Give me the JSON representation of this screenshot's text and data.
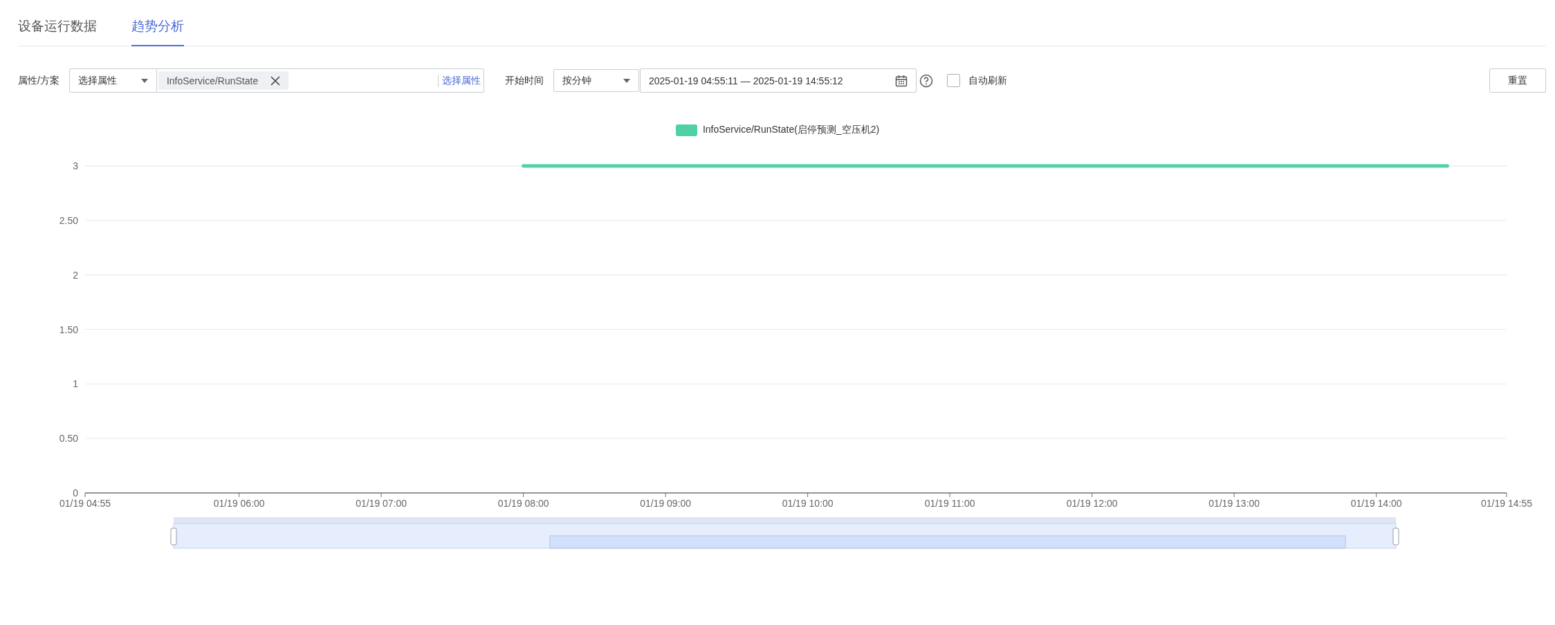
{
  "tabs": [
    {
      "label": "设备运行数据",
      "selected": false
    },
    {
      "label": "趋势分析",
      "selected": true
    }
  ],
  "filters": {
    "attribute_label": "属性/方案",
    "attribute_select": "选择属性",
    "attribute_tag": "InfoService/RunState",
    "attribute_link": "选择属性",
    "time_label": "开始时间",
    "granularity_select": "按分钟",
    "date_range": "2025-01-19 04:55:11 — 2025-01-19 14:55:12",
    "auto_refresh": {
      "label": "自动刷新",
      "checked": false
    },
    "reset_button": "重置"
  },
  "chart_data": {
    "type": "line",
    "grid": true,
    "categories": [
      "01/19 04:55",
      null,
      null,
      null,
      null,
      null,
      null,
      null,
      null,
      null,
      null,
      null,
      null,
      "01/19 06:00",
      null,
      null,
      null,
      null,
      null,
      null,
      null,
      null,
      null,
      null,
      null,
      "01/19 07:00",
      null,
      null,
      null,
      null,
      null,
      null,
      null,
      null,
      null,
      null,
      null,
      "01/19 08:00",
      null,
      null,
      null,
      null,
      null,
      null,
      null,
      null,
      null,
      null,
      null,
      "01/19 09:00",
      null,
      null,
      null,
      null,
      null,
      null,
      null,
      null,
      null,
      null,
      null,
      "01/19 10:00",
      null,
      null,
      null,
      null,
      null,
      null,
      null,
      null,
      null,
      null,
      null,
      "01/19 11:00",
      null,
      null,
      null,
      null,
      null,
      null,
      null,
      null,
      null,
      null,
      null,
      "01/19 12:00",
      null,
      null,
      null,
      null,
      null,
      null,
      null,
      null,
      null,
      null,
      null,
      "01/19 13:00",
      null,
      null,
      null,
      null,
      null,
      null,
      null,
      null,
      null,
      null,
      null,
      "01/19 14:00",
      null,
      null,
      null,
      null,
      null,
      null,
      null,
      null,
      null,
      null,
      "01/19 14:55"
    ],
    "series": [
      {
        "name": "InfoService/RunState(启停预测_空压机2)",
        "color": "#4fd1a5",
        "values": [
          null,
          null,
          null,
          null,
          null,
          null,
          null,
          null,
          null,
          null,
          null,
          null,
          null,
          null,
          null,
          null,
          null,
          null,
          null,
          null,
          null,
          null,
          null,
          null,
          null,
          null,
          null,
          null,
          null,
          null,
          null,
          null,
          null,
          null,
          null,
          null,
          null,
          3,
          3,
          3,
          3,
          3,
          3,
          3,
          3,
          3,
          3,
          3,
          3,
          3,
          3,
          3,
          3,
          3,
          3,
          3,
          3,
          3,
          3,
          3,
          3,
          3,
          3,
          3,
          3,
          3,
          3,
          3,
          3,
          3,
          3,
          3,
          3,
          3,
          3,
          3,
          3,
          3,
          3,
          3,
          3,
          3,
          3,
          3,
          3,
          3,
          3,
          3,
          3,
          3,
          3,
          3,
          3,
          3,
          3,
          3,
          3,
          3,
          3,
          3,
          3,
          3,
          3,
          3,
          3,
          3,
          3,
          3,
          3,
          3,
          3,
          3,
          3,
          3,
          3,
          3,
          null,
          null,
          null,
          null,
          null
        ]
      }
    ],
    "ylim": [
      0,
      3
    ],
    "yticks": [
      0,
      {
        "value": 0.5,
        "label": "0.50"
      },
      1,
      {
        "value": 1.5,
        "label": "1.50"
      },
      2,
      {
        "value": 2.5,
        "label": "2.50"
      },
      3
    ]
  }
}
